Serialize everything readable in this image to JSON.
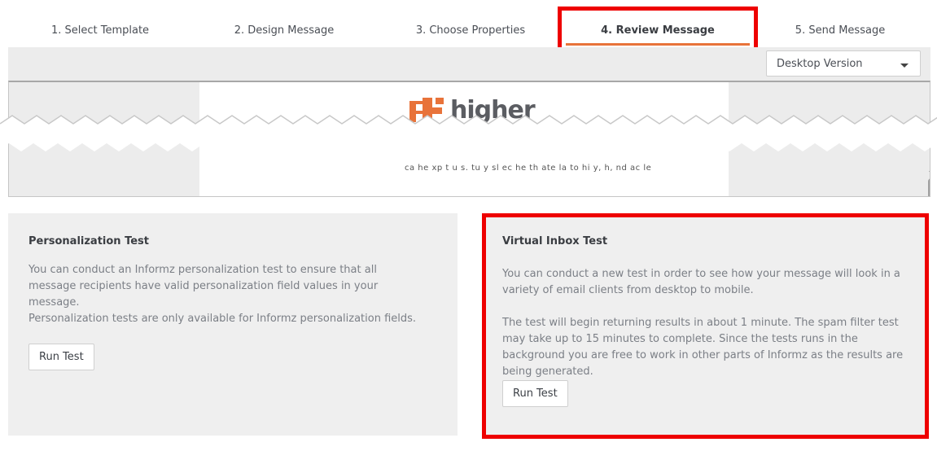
{
  "steps": [
    {
      "label": "1. Select Template"
    },
    {
      "label": "2. Design Message"
    },
    {
      "label": "3. Choose Properties"
    },
    {
      "label": "4. Review Message",
      "active": true
    },
    {
      "label": "5. Send Message"
    }
  ],
  "colors": {
    "accent": "#e8733a",
    "highlight": "#ee0000",
    "panel_bg": "#efefef"
  },
  "preview": {
    "version_select": "Desktop Version",
    "logo_text": "higher",
    "garbled_text": "ca  he   xp  t  u s.  tu  y  sl  ec    he    th   ate    la   to    hi     y,    h,   nd    ac  le"
  },
  "personalization": {
    "title": "Personalization Test",
    "text1": "You can conduct an Informz personalization test to ensure that all message recipients have valid personalization field values in your message.",
    "text2": "Personalization tests are only available for Informz personalization fields.",
    "button": "Run Test"
  },
  "virtual_inbox": {
    "title": "Virtual Inbox Test",
    "text1": "You can conduct a new test in order to see how your message will look in a variety of email clients from desktop to mobile.",
    "text2": "The test will begin returning results in about 1 minute. The spam filter test may take up to 15 minutes to complete. Since the tests runs in the background you are free to work in other parts of Informz as the results are being generated.",
    "button": "Run Test"
  }
}
